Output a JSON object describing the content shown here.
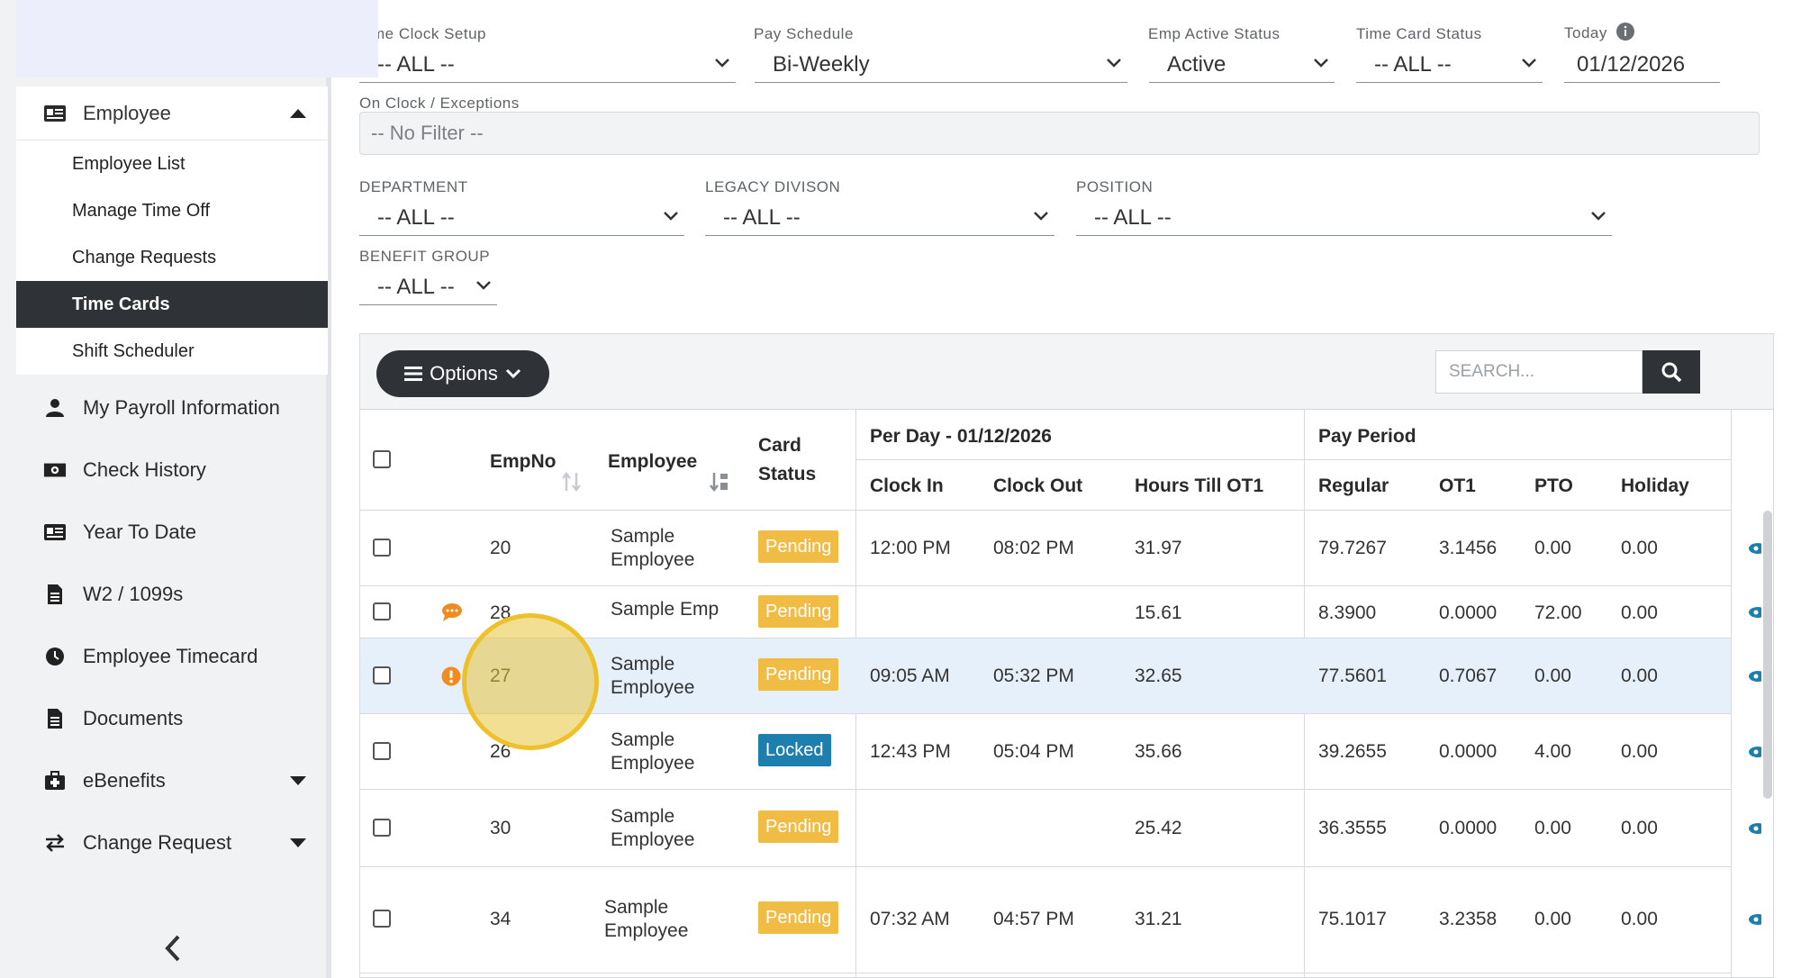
{
  "sidebar": {
    "group": {
      "label": "Employee"
    },
    "submenu": [
      {
        "label": "Employee List",
        "active": false
      },
      {
        "label": "Manage Time Off",
        "active": false
      },
      {
        "label": "Change Requests",
        "active": false
      },
      {
        "label": "Time Cards",
        "active": true
      },
      {
        "label": "Shift Scheduler",
        "active": false
      }
    ],
    "items": [
      {
        "label": "My Payroll Information",
        "icon": "user-icon"
      },
      {
        "label": "Check History",
        "icon": "money-icon"
      },
      {
        "label": "Year To Date",
        "icon": "id-card-icon"
      },
      {
        "label": "W2 / 1099s",
        "icon": "document-icon"
      },
      {
        "label": "Employee Timecard",
        "icon": "clock-icon"
      },
      {
        "label": "Documents",
        "icon": "document-icon"
      },
      {
        "label": "eBenefits",
        "icon": "medkit-icon"
      },
      {
        "label": "Change Request",
        "icon": "exchange-icon"
      }
    ]
  },
  "filters": {
    "time_clock_setup": {
      "label": "me Clock Setup",
      "value": "-- ALL --"
    },
    "pay_schedule": {
      "label": "Pay Schedule",
      "value": "Bi-Weekly"
    },
    "emp_active_status": {
      "label": "Emp Active Status",
      "value": "Active"
    },
    "time_card_status": {
      "label": "Time Card Status",
      "value": "-- ALL --"
    },
    "today": {
      "label": "Today",
      "value": "01/12/2026"
    },
    "on_clock": {
      "label": "On Clock / Exceptions",
      "value": "-- No Filter --"
    },
    "department": {
      "label": "DEPARTMENT",
      "value": "-- ALL --"
    },
    "legacy_division": {
      "label": "LEGACY DIVISON",
      "value": "-- ALL --"
    },
    "position": {
      "label": "POSITION",
      "value": "-- ALL --"
    },
    "benefit_group": {
      "label": "BENEFIT GROUP",
      "value": "-- ALL --"
    }
  },
  "toolbar": {
    "options_label": "Options",
    "search_placeholder": "SEARCH..."
  },
  "table": {
    "headers": {
      "empno": "EmpNo",
      "employee": "Employee",
      "card_status_1": "Card",
      "card_status_2": "Status",
      "per_day": "Per Day - 01/12/2026",
      "pay_period": "Pay Period",
      "clock_in": "Clock In",
      "clock_out": "Clock Out",
      "hours_till_ot1": "Hours Till OT1",
      "regular": "Regular",
      "ot1": "OT1",
      "pto": "PTO",
      "holiday": "Holiday"
    },
    "rows": [
      {
        "empno": "20",
        "employee": "Sample Employee",
        "status": "Pending",
        "clock_in": "12:00 PM",
        "clock_out": "08:02 PM",
        "hours_till_ot1": "31.97",
        "regular": "79.7267",
        "ot1": "3.1456",
        "pto": "0.00",
        "holiday": "0.00",
        "flag": ""
      },
      {
        "empno": "28",
        "employee": "Sample Emp",
        "status": "Pending",
        "clock_in": "",
        "clock_out": "",
        "hours_till_ot1": "15.61",
        "regular": "8.3900",
        "ot1": "0.0000",
        "pto": "72.00",
        "holiday": "0.00",
        "flag": "comment"
      },
      {
        "empno": "27",
        "employee": "Sample Employee",
        "status": "Pending",
        "clock_in": "09:05 AM",
        "clock_out": "05:32 PM",
        "hours_till_ot1": "32.65",
        "regular": "77.5601",
        "ot1": "0.7067",
        "pto": "0.00",
        "holiday": "0.00",
        "flag": "exception"
      },
      {
        "empno": "26",
        "employee": "Sample Employee",
        "status": "Locked",
        "clock_in": "12:43 PM",
        "clock_out": "05:04 PM",
        "hours_till_ot1": "35.66",
        "regular": "39.2655",
        "ot1": "0.0000",
        "pto": "4.00",
        "holiday": "0.00",
        "flag": ""
      },
      {
        "empno": "30",
        "employee": "Sample Employee",
        "status": "Pending",
        "clock_in": "",
        "clock_out": "",
        "hours_till_ot1": "25.42",
        "regular": "36.3555",
        "ot1": "0.0000",
        "pto": "0.00",
        "holiday": "0.00",
        "flag": ""
      },
      {
        "empno": "34",
        "employee": "Sample Employee",
        "status": "Pending",
        "clock_in": "07:32 AM",
        "clock_out": "04:57 PM",
        "hours_till_ot1": "31.21",
        "regular": "75.1017",
        "ot1": "3.2358",
        "pto": "0.00",
        "holiday": "0.00",
        "flag": ""
      }
    ]
  },
  "colors": {
    "sidebar_active": "#2f3237",
    "pending": "#f0bc44",
    "locked": "#1d7fae",
    "row_highlight": "#e5f0fa",
    "comment_flag": "#f08c1e",
    "exception_flag": "#f08c1e"
  }
}
